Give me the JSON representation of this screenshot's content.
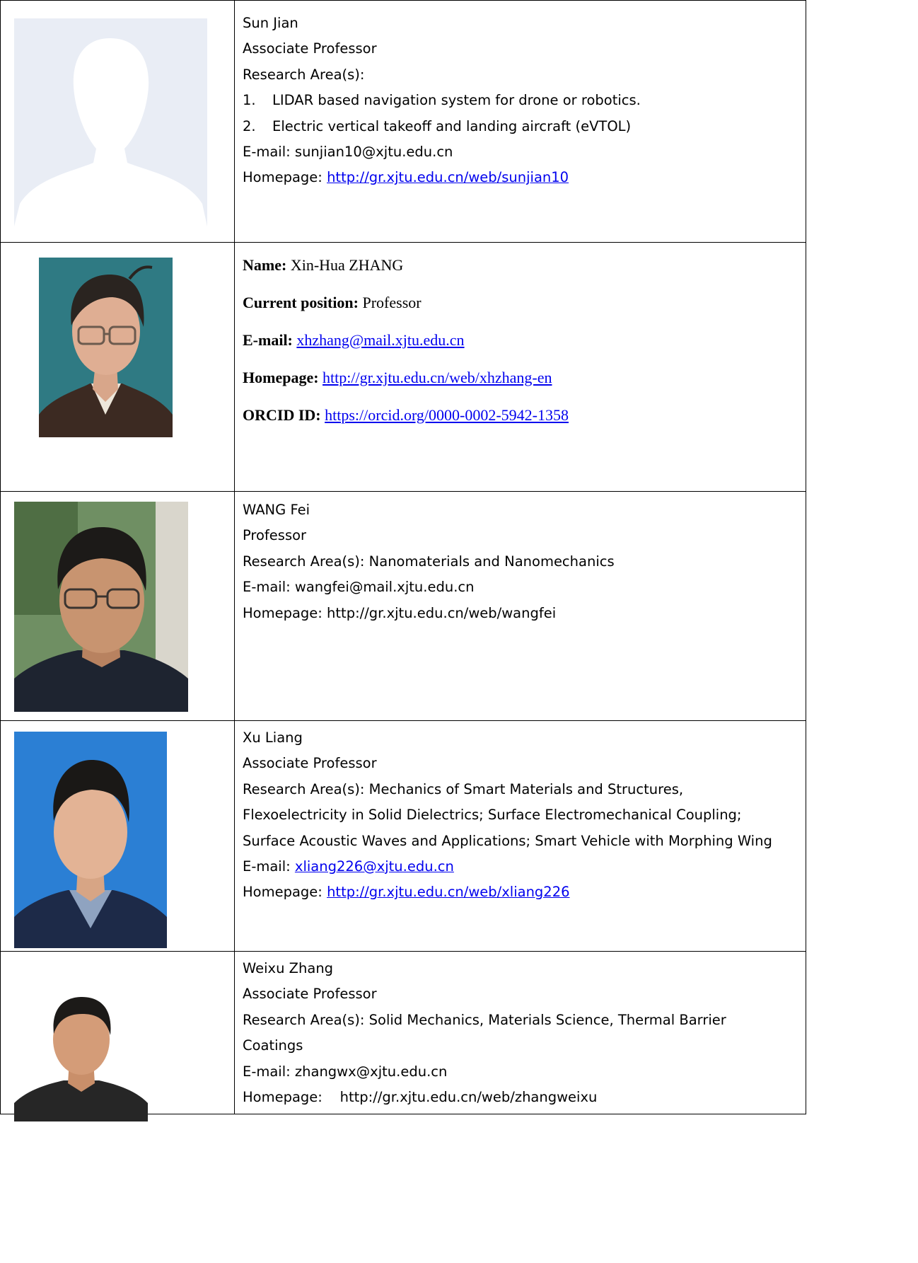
{
  "people": [
    {
      "name": "Sun Jian",
      "title": "Associate Professor",
      "research_label": "Research Area(s):",
      "research_items": [
        {
          "num": "1.",
          "text": "LIDAR based navigation system for drone or robotics."
        },
        {
          "num": "2.",
          "text": "Electric vertical takeoff and landing aircraft (eVTOL)"
        }
      ],
      "email_label": "E-mail: ",
      "email": "sunjian10@xjtu.edu.cn",
      "homepage_label": "Homepage: ",
      "homepage": "http://gr.xjtu.edu.cn/web/sunjian10",
      "photo_icon": "placeholder-avatar-icon"
    },
    {
      "name_label": "Name:",
      "name": " Xin-Hua ZHANG",
      "position_label": "Current position:",
      "position": " Professor",
      "email_label": "E-mail:",
      "email": "xhzhang@mail.xjtu.edu.cn",
      "homepage_label": "Homepage:",
      "homepage": "http://gr.xjtu.edu.cn/web/xhzhang-en",
      "orcid_label": "ORCID ID:",
      "orcid": "https://orcid.org/0000-0002-5942-1358"
    },
    {
      "name": "WANG Fei",
      "title": "Professor",
      "research": "Research Area(s): Nanomaterials and Nanomechanics",
      "email": "E-mail: wangfei@mail.xjtu.edu.cn",
      "homepage": "Homepage: http://gr.xjtu.edu.cn/web/wangfei"
    },
    {
      "name": "Xu Liang",
      "title": "Associate Professor",
      "research_lines": [
        "Research Area(s): Mechanics of Smart Materials and Structures,",
        "Flexoelectricity in Solid Dielectrics; Surface Electromechanical Coupling;",
        "Surface Acoustic Waves and Applications; Smart Vehicle with Morphing Wing"
      ],
      "email_label": "E-mail: ",
      "email": "xliang226@xjtu.edu.cn",
      "homepage_label": "Homepage: ",
      "homepage": "http://gr.xjtu.edu.cn/web/xliang226"
    },
    {
      "name": "Weixu Zhang",
      "title": "Associate Professor",
      "research_lines": [
        "Research Area(s): Solid Mechanics, Materials Science, Thermal Barrier",
        "Coatings"
      ],
      "email": "E-mail: zhangwx@xjtu.edu.cn",
      "homepage": "Homepage:    http://gr.xjtu.edu.cn/web/zhangweixu"
    }
  ],
  "colors": {
    "link": "#0000ee",
    "border": "#000000",
    "placeholder_bg": "#e9edf5",
    "placeholder_silhouette": "#ffffff",
    "photo2_bg": "#2f7a83",
    "photo4_bg": "#2b7fd4",
    "photo5_bg": "#ffffff"
  }
}
